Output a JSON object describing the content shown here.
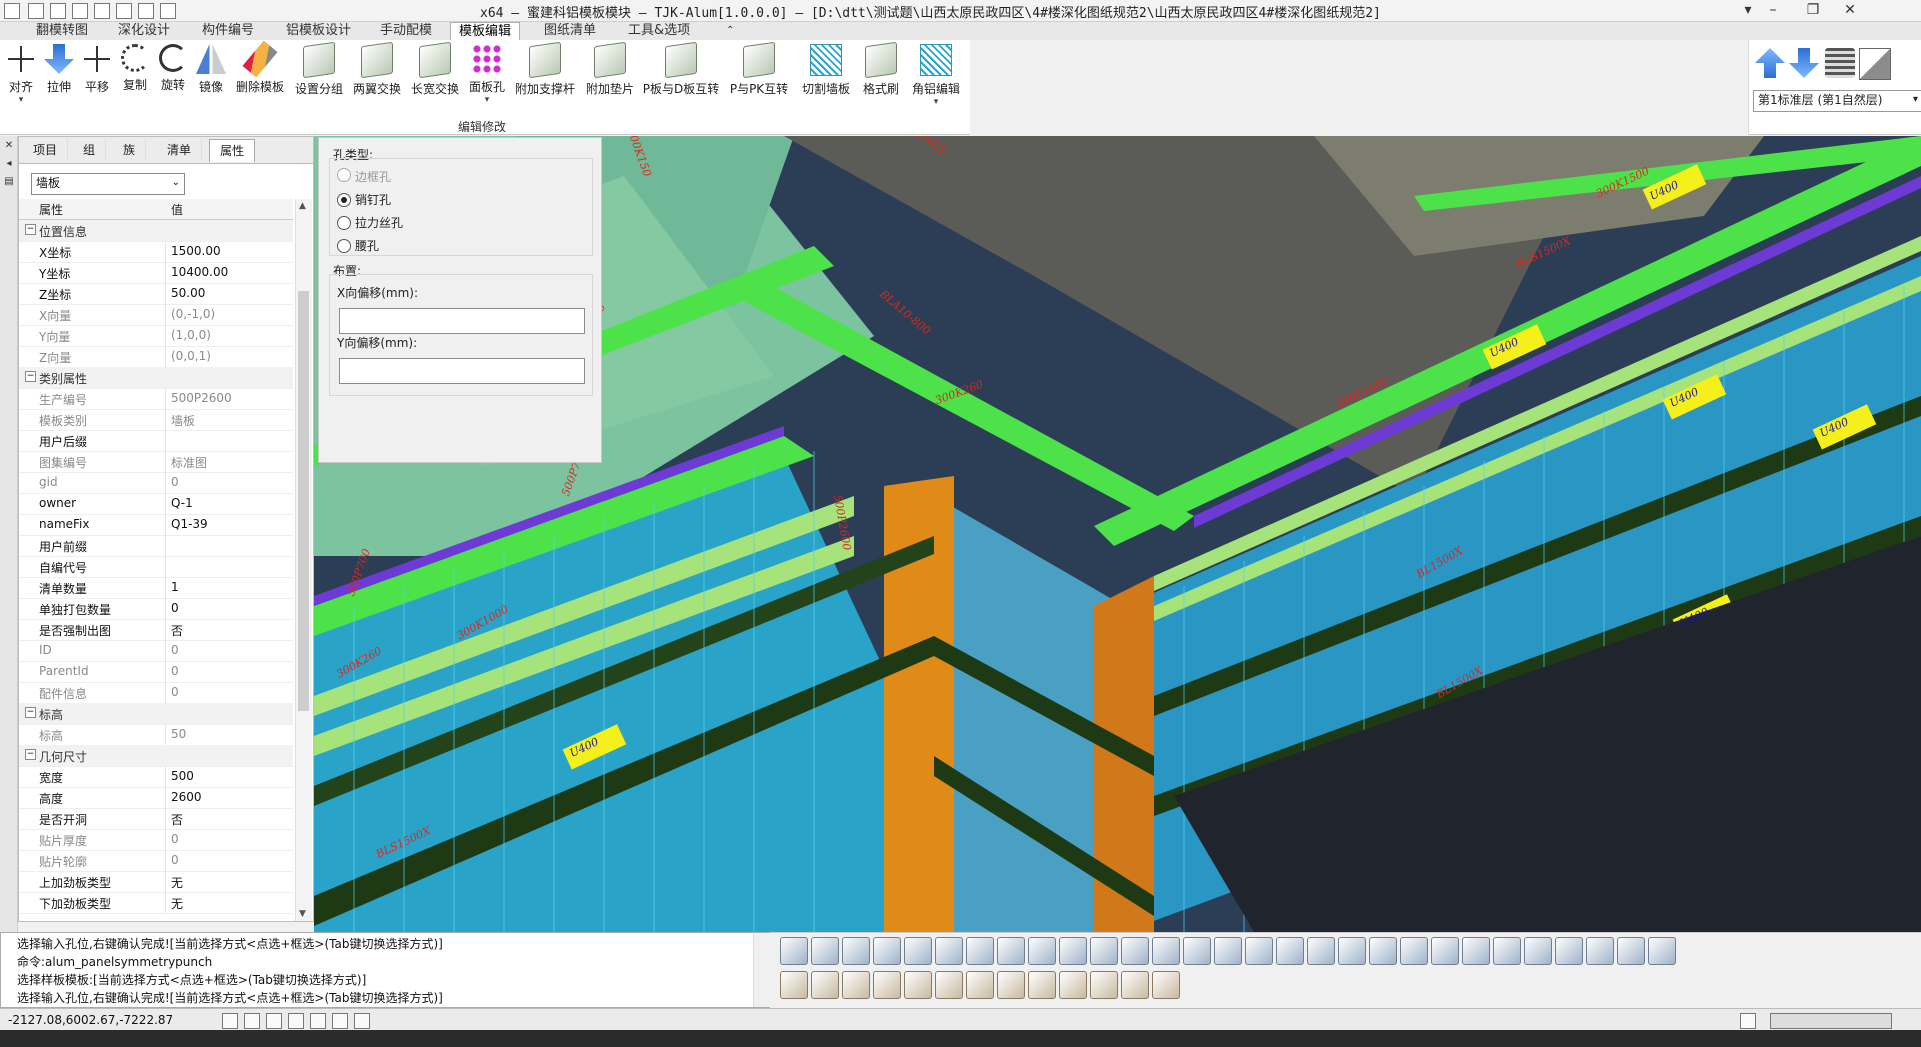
{
  "window": {
    "title": "x64 — 蜜建科铝模板模块 — TJK-Alum[1.0.0.0] — [D:\\dtt\\测试题\\山西太原民政四区\\4#楼深化图纸规范2\\山西太原民政四区4#楼深化图纸规范2]"
  },
  "ribbon_tabs": [
    "翻模转图",
    "深化设计",
    "构件编号",
    "铝模板设计",
    "手动配模",
    "模板编辑",
    "图纸清单",
    "工具&选项"
  ],
  "active_tab": "模板编辑",
  "ribbon": {
    "group_label": "编辑修改",
    "buttons": [
      "对齐",
      "拉伸",
      "平移",
      "复制",
      "旋转",
      "镜像",
      "删除模板",
      "设置分组",
      "两翼交换",
      "长宽交换",
      "面板孔",
      "附加支撑杆",
      "附加垫片",
      "P板与D板互转",
      "P与PK互转",
      "切割墙板",
      "格式刷",
      "角铝编辑"
    ]
  },
  "floor_select": {
    "value": "第1标准层 (第1自然层)"
  },
  "panel_tabs": [
    "项目",
    "组",
    "族",
    "清单",
    "属性"
  ],
  "active_panel_tab": "属性",
  "type_select": {
    "value": "墙板"
  },
  "grid_header": {
    "key": "属性",
    "value": "值"
  },
  "properties": [
    {
      "type": "group",
      "key": "位置信息"
    },
    {
      "key": "X坐标",
      "value": "1500.00"
    },
    {
      "key": "Y坐标",
      "value": "10400.00"
    },
    {
      "key": "Z坐标",
      "value": "50.00"
    },
    {
      "key": "X向量",
      "value": "(0,-1,0)",
      "dim": true
    },
    {
      "key": "Y向量",
      "value": "(1,0,0)",
      "dim": true
    },
    {
      "key": "Z向量",
      "value": "(0,0,1)",
      "dim": true
    },
    {
      "type": "group",
      "key": "类别属性"
    },
    {
      "key": "生产编号",
      "value": "500P2600",
      "dim": true
    },
    {
      "key": "模板类别",
      "value": "墙板",
      "dim": true
    },
    {
      "key": "用户后缀",
      "value": ""
    },
    {
      "key": "图集编号",
      "value": "标准图",
      "dim": true
    },
    {
      "key": "gid",
      "value": "0",
      "dim": true
    },
    {
      "key": "owner",
      "value": "Q-1"
    },
    {
      "key": "nameFix",
      "value": "Q1-39"
    },
    {
      "key": "用户前缀",
      "value": ""
    },
    {
      "key": "自编代号",
      "value": ""
    },
    {
      "key": "清单数量",
      "value": "1"
    },
    {
      "key": "单独打包数量",
      "value": "0"
    },
    {
      "key": "是否强制出图",
      "value": "否"
    },
    {
      "key": "ID",
      "value": "0",
      "dim": true
    },
    {
      "key": "ParentId",
      "value": "0",
      "dim": true
    },
    {
      "key": "配件信息",
      "value": "0",
      "dim": true
    },
    {
      "type": "group",
      "key": "标高"
    },
    {
      "key": "标高",
      "value": "50",
      "dim": true
    },
    {
      "type": "group",
      "key": "几何尺寸"
    },
    {
      "key": "宽度",
      "value": "500"
    },
    {
      "key": "高度",
      "value": "2600"
    },
    {
      "key": "是否开洞",
      "value": "否"
    },
    {
      "key": "贴片厚度",
      "value": "0",
      "dim": true
    },
    {
      "key": "贴片轮廓",
      "value": "0",
      "dim": true
    },
    {
      "key": "上加劲板类型",
      "value": "无"
    },
    {
      "key": "下加劲板类型",
      "value": "无"
    }
  ],
  "hole_dialog": {
    "hole_type_label": "孔类型:",
    "options": [
      {
        "label": "边框孔",
        "state": "disabled"
      },
      {
        "label": "销钉孔",
        "state": "selected"
      },
      {
        "label": "拉力丝孔",
        "state": "normal"
      },
      {
        "label": "腰孔",
        "state": "normal"
      }
    ],
    "layout_label": "布置:",
    "x_offset_label": "X向偏移(mm):",
    "x_offset_value": "",
    "y_offset_label": "Y向偏移(mm):",
    "y_offset_value": ""
  },
  "viewport_labels": [
    "500P700",
    "500P700",
    "500P700",
    "500P700",
    "300K1000",
    "300K1600",
    "300K1500",
    "300K260",
    "300K260",
    "U400",
    "U400",
    "U400",
    "U400",
    "U400",
    "U400",
    "L350",
    "500P2600",
    "BL1500X",
    "BL1500X",
    "BLS1500X",
    "BLS1500X",
    "BLA10-800",
    "TWC2",
    "300K150"
  ],
  "command": {
    "lines": [
      "选择输入孔位,右键确认完成![当前选择方式<点选+框选>(Tab键切换选择方式)]",
      "命令:alum_panelsymmetrypunch",
      "选择样板模板:[当前选择方式<点选+框选>(Tab键切换选择方式)]",
      "选择输入孔位,右键确认完成![当前选择方式<点选+框选>(Tab键切换选择方式)]"
    ]
  },
  "status": {
    "coordinates": "-2127.08,6002.67,-7222.87"
  },
  "colors": {
    "viewport_bg": "#1f2a3a",
    "wall_blue": "#2aa3c9",
    "beam_green": "#4de24a",
    "dark_rail": "#1d3a14",
    "orange_column": "#e08a18",
    "label_red": "#d8281f",
    "sticker_yellow": "#f5ef1a",
    "violet": "#6e3ad6"
  }
}
